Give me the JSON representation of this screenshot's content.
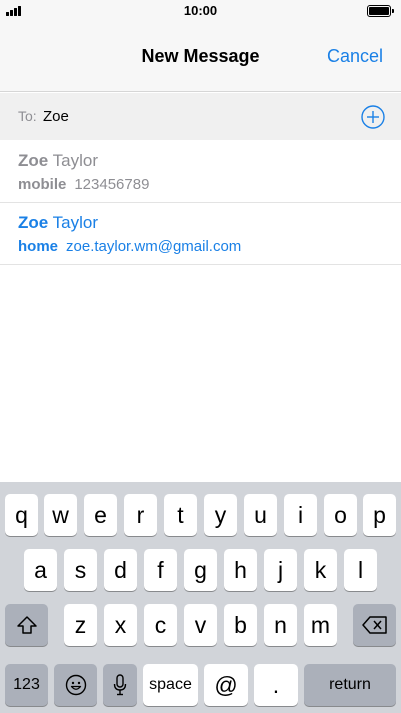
{
  "status_bar": {
    "time": "10:00"
  },
  "nav": {
    "title": "New Message",
    "cancel_label": "Cancel"
  },
  "to_field": {
    "label": "To:",
    "value": "Zoe"
  },
  "suggestions": [
    {
      "first_name": "Zoe",
      "last_name": "Taylor",
      "type": "mobile",
      "value": "123456789",
      "highlighted": false
    },
    {
      "first_name": "Zoe",
      "last_name": "Taylor",
      "type": "home",
      "value": "zoe.taylor.wm@gmail.com",
      "highlighted": true
    }
  ],
  "keyboard": {
    "row1": [
      "q",
      "w",
      "e",
      "r",
      "t",
      "y",
      "u",
      "i",
      "o",
      "p"
    ],
    "row2": [
      "a",
      "s",
      "d",
      "f",
      "g",
      "h",
      "j",
      "k",
      "l"
    ],
    "row3": [
      "z",
      "x",
      "c",
      "v",
      "b",
      "n",
      "m"
    ],
    "numbers_label": "123",
    "space_label": "space",
    "at_label": "@",
    "period_label": ".",
    "return_label": "return"
  },
  "colors": {
    "accent": "#1a80e6",
    "muted": "#8e8e93",
    "keyboard_bg": "#d1d4d9"
  },
  "icons": {
    "add": "plus-circle-icon",
    "shift": "shift-icon",
    "delete": "backspace-icon",
    "emoji": "emoji-icon",
    "dictation": "microphone-icon"
  }
}
